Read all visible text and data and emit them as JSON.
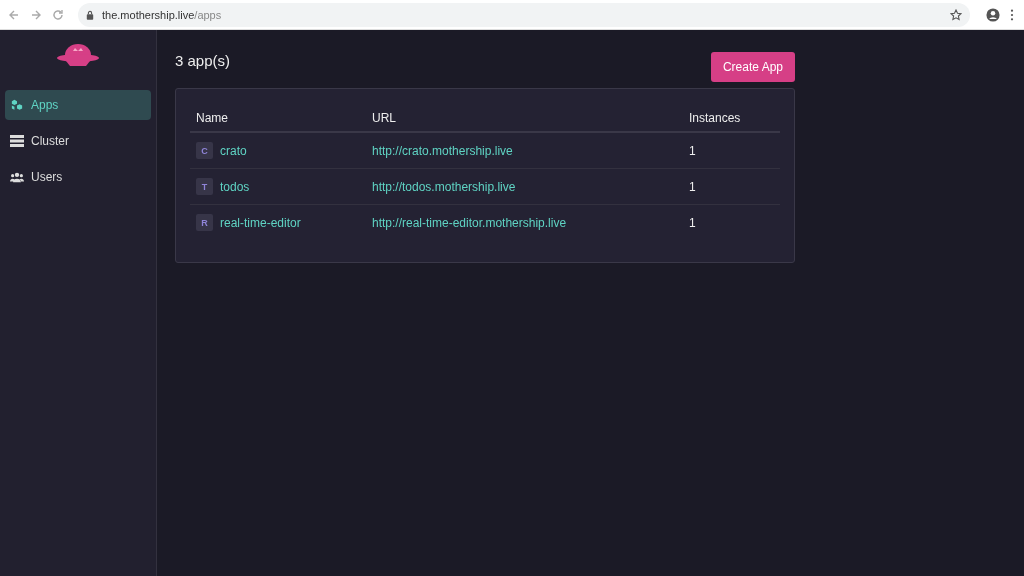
{
  "browser": {
    "url_host": "the.mothership.live",
    "url_path": "/apps"
  },
  "sidebar": {
    "items": [
      {
        "label": "Apps",
        "selected": true
      },
      {
        "label": "Cluster",
        "selected": false
      },
      {
        "label": "Users",
        "selected": false
      }
    ]
  },
  "header": {
    "count": "3 app(s)",
    "button": "Create App"
  },
  "table": {
    "columns": [
      "Name",
      "URL",
      "Instances"
    ],
    "rows": [
      {
        "initial": "C",
        "name": "crato",
        "url": "http://crato.mothership.live",
        "instances": "1"
      },
      {
        "initial": "T",
        "name": "todos",
        "url": "http://todos.mothership.live",
        "instances": "1"
      },
      {
        "initial": "R",
        "name": "real-time-editor",
        "url": "http://real-time-editor.mothership.live",
        "instances": "1"
      }
    ]
  }
}
